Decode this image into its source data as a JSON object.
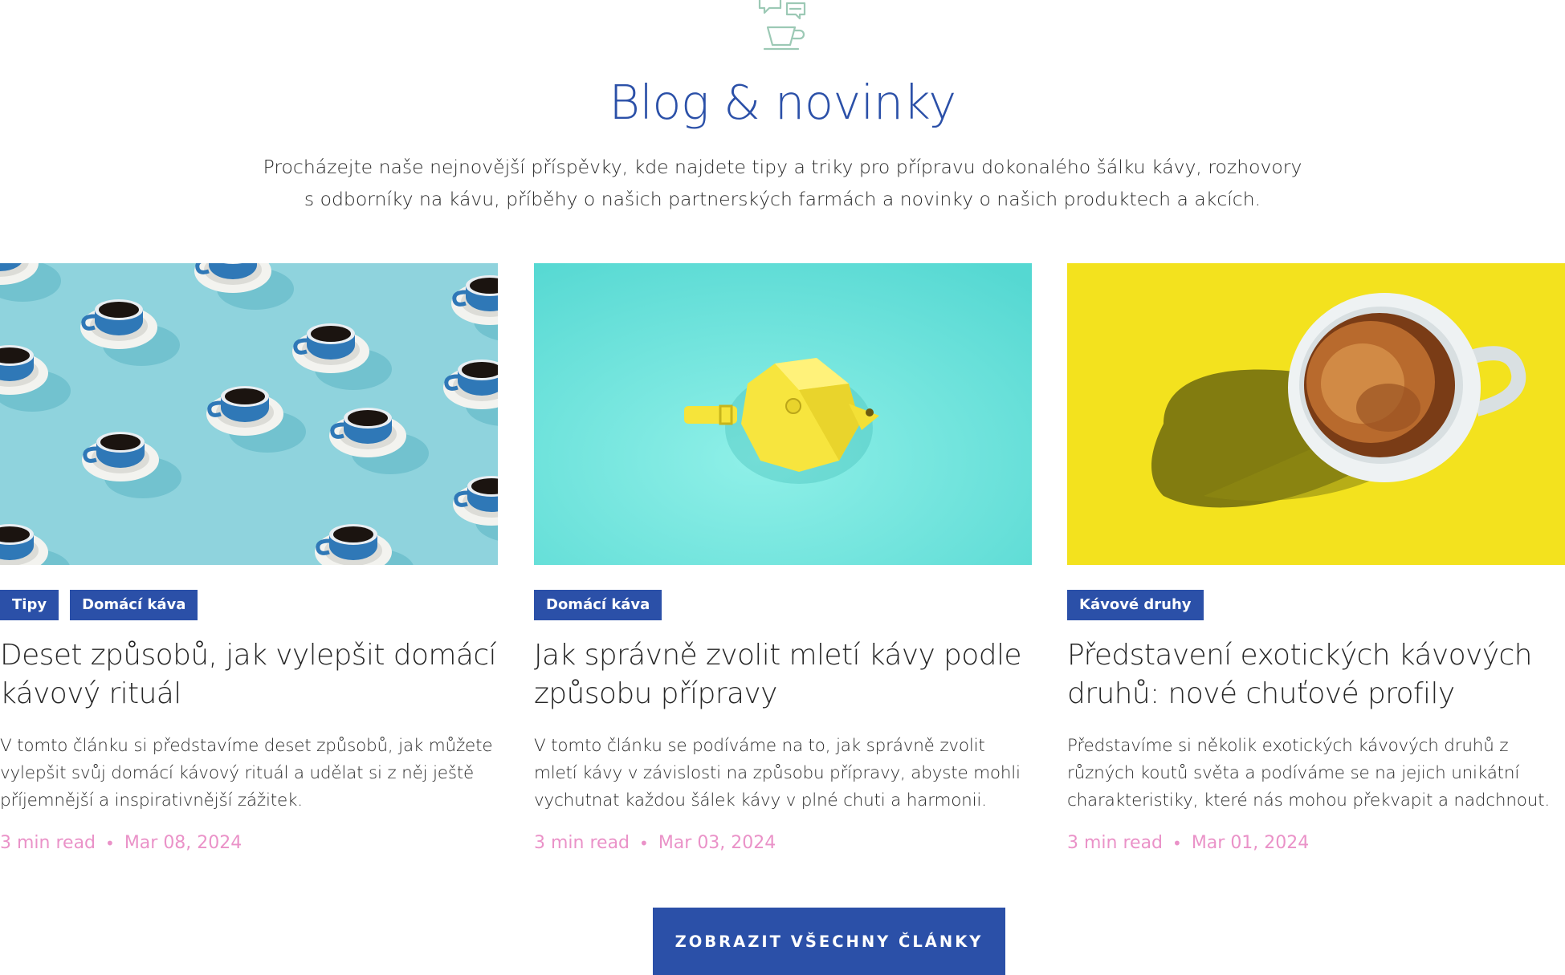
{
  "section": {
    "title": "Blog & novinky",
    "intro_line1": "Procházejte naše nejnovější příspěvky, kde najdete tipy a triky pro přípravu dokonalého šálku kávy, rozhovory",
    "intro_line2": "s odborníky na kávu, příběhy o našich partnerských farmách a novinky o našich produktech a akcích.",
    "logo_icon": "coffee-cup-chat-icon"
  },
  "posts": [
    {
      "image": "blue coffee cups on light blue background",
      "tags": [
        "Tipy",
        "Domácí káva"
      ],
      "title": "Deset způsobů, jak vylepšit domácí kávový rituál",
      "excerpt": "V tomto článku si představíme deset způsobů, jak můžete vylepšit svůj domácí kávový rituál a udělat si z něj ještě příjemnější a inspirativnější zážitek.",
      "read_time": "3 min read",
      "separator": "•",
      "date": "Mar 08, 2024"
    },
    {
      "image": "yellow moka pot on turquoise background",
      "tags": [
        "Domácí káva"
      ],
      "title": "Jak správně zvolit mletí kávy podle způsobu přípravy",
      "excerpt": "V tomto článku se podíváme na to, jak správně zvolit mletí kávy v závislosti na způsobu přípravy, abyste mohli vychutnat každou šálek kávy v plné chuti a harmonii.",
      "read_time": "3 min read",
      "separator": "•",
      "date": "Mar 03, 2024"
    },
    {
      "image": "white espresso cup on yellow background",
      "tags": [
        "Kávové druhy"
      ],
      "title": "Představení exotických kávových druhů: nové chuťové profily",
      "excerpt": "Představíme si několik exotických kávových druhů z různých koutů světa a podíváme se na jejich unikátní charakteristiky, které nás mohou překvapit a nadchnout.",
      "read_time": "3 min read",
      "separator": "•",
      "date": "Mar 01, 2024"
    }
  ],
  "cta": {
    "label": "ZOBRAZIT VŠECHNY ČLÁNKY"
  },
  "colors": {
    "accent": "#2b50a8",
    "meta": "#ea92c8",
    "logo": "#9cc9b5"
  }
}
